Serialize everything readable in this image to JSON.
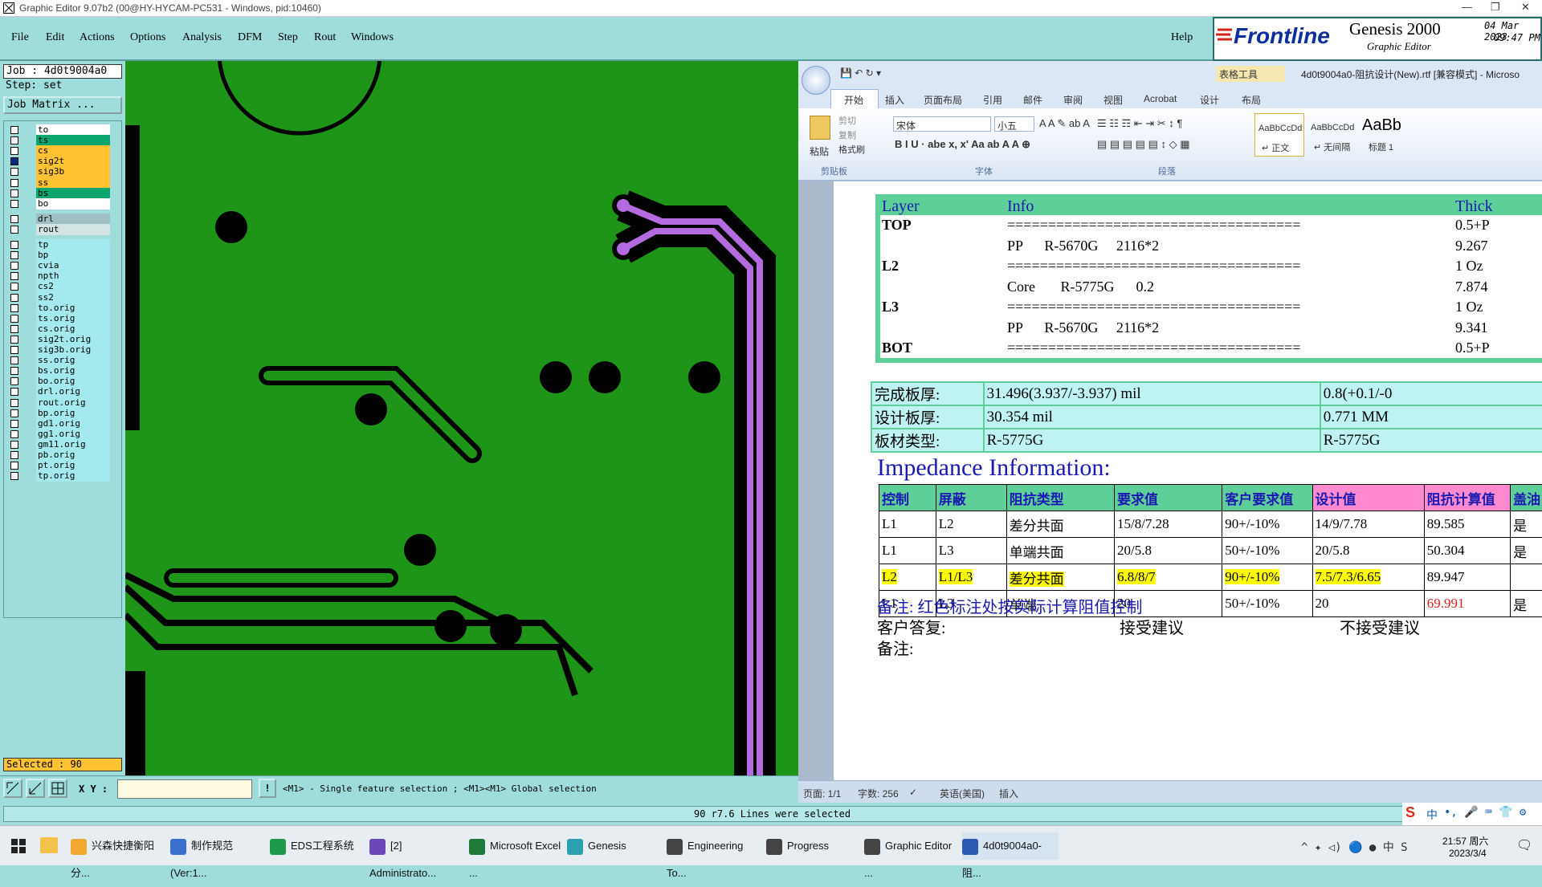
{
  "window": {
    "title": "Graphic Editor 9.07b2 (00@HY-HYCAM-PC531 - Windows, pid:10460)"
  },
  "menu": [
    "File",
    "Edit",
    "Actions",
    "Options",
    "Analysis",
    "DFM",
    "Step",
    "Rout",
    "Windows"
  ],
  "menu_help": "Help",
  "logo": {
    "brand": "Frontline",
    "product": "Genesis 2000",
    "subtitle": "Graphic Editor",
    "date": "04 Mar 2023",
    "time": "09:47 PM"
  },
  "job": {
    "job_line": "Job : 4d0t9004a0",
    "step_line": "Step: set",
    "matrix_button": "Job Matrix ..."
  },
  "layers": [
    {
      "name": "to",
      "color": "#ffffff"
    },
    {
      "name": "ts",
      "color": "#0aa66e"
    },
    {
      "name": "cs",
      "color": "#ffc233"
    },
    {
      "name": "sig2t",
      "color": "#ffc233"
    },
    {
      "name": "sig3b",
      "color": "#ffc233"
    },
    {
      "name": "ss",
      "color": "#ffc233"
    },
    {
      "name": "bs",
      "color": "#0aa66e"
    },
    {
      "name": "bo",
      "color": "#ffffff"
    },
    {
      "name": "drl",
      "color": "#9fbfc4"
    },
    {
      "name": "rout",
      "color": "#d4e4e4"
    },
    {
      "name": "tp",
      "color": "#a3e9ee"
    },
    {
      "name": "bp",
      "color": "#a3e9ee"
    },
    {
      "name": "cvia",
      "color": "#a3e9ee"
    },
    {
      "name": "npth",
      "color": "#a3e9ee"
    },
    {
      "name": "cs2",
      "color": "#a3e9ee"
    },
    {
      "name": "ss2",
      "color": "#a3e9ee"
    },
    {
      "name": "to.orig",
      "color": "#a3e9ee"
    },
    {
      "name": "ts.orig",
      "color": "#a3e9ee"
    },
    {
      "name": "cs.orig",
      "color": "#a3e9ee"
    },
    {
      "name": "sig2t.orig",
      "color": "#a3e9ee"
    },
    {
      "name": "sig3b.orig",
      "color": "#a3e9ee"
    },
    {
      "name": "ss.orig",
      "color": "#a3e9ee"
    },
    {
      "name": "bs.orig",
      "color": "#a3e9ee"
    },
    {
      "name": "bo.orig",
      "color": "#a3e9ee"
    },
    {
      "name": "drl.orig",
      "color": "#a3e9ee"
    },
    {
      "name": "rout.orig",
      "color": "#a3e9ee"
    },
    {
      "name": "bp.orig",
      "color": "#a3e9ee"
    },
    {
      "name": "gd1.orig",
      "color": "#a3e9ee"
    },
    {
      "name": "gg1.orig",
      "color": "#a3e9ee"
    },
    {
      "name": "gm11.orig",
      "color": "#a3e9ee"
    },
    {
      "name": "pb.orig",
      "color": "#a3e9ee"
    },
    {
      "name": "pt.orig",
      "color": "#a3e9ee"
    },
    {
      "name": "tp.orig",
      "color": "#a3e9ee"
    }
  ],
  "selected_count": "Selected : 90",
  "cmd": {
    "xy_label": "X Y :",
    "hint": "<M1> - Single feature selection ; <M1><M1> Global selection"
  },
  "status_message": "90 r7.6 Lines were selected",
  "word": {
    "doc_title": "4d0t9004a0-阻抗设计(New).rtf [兼容模式] - Microso",
    "context_tab": "表格工具",
    "tabs": [
      "开始",
      "插入",
      "页面布局",
      "引用",
      "邮件",
      "审阅",
      "视图",
      "Acrobat",
      "设计",
      "布局"
    ],
    "clipboard": {
      "paste": "粘贴",
      "cut": "剪切",
      "copy": "复制",
      "painter": "格式刷",
      "group": "剪贴板"
    },
    "font": {
      "name": "宋体",
      "size": "小五",
      "group": "字体"
    },
    "para_group": "段落",
    "styles": [
      {
        "sample": "AaBbCcDd",
        "label": "↵ 正文"
      },
      {
        "sample": "AaBbCcDd",
        "label": "↵ 无间隔"
      },
      {
        "sample": "AaBb",
        "label": "标题 1"
      }
    ],
    "stack_header": [
      "Layer",
      "Info",
      "Thick"
    ],
    "stack_rows": [
      [
        "TOP",
        "====================================",
        "0.5+P"
      ],
      [
        "",
        "PP      R-5670G     2116*2",
        "9.267"
      ],
      [
        "L2",
        "====================================",
        "1 Oz"
      ],
      [
        "",
        "Core       R-5775G      0.2",
        "7.874"
      ],
      [
        "L3",
        "====================================",
        "1 Oz"
      ],
      [
        "",
        "PP      R-5670G     2116*2",
        "9.341"
      ],
      [
        "BOT",
        "====================================",
        "0.5+P"
      ]
    ],
    "thickness_rows": [
      [
        "完成板厚:",
        "31.496(3.937/-3.937) mil",
        "0.8(+0.1/-0"
      ],
      [
        "设计板厚:",
        "30.354 mil",
        "0.771 MM"
      ],
      [
        "板材类型:",
        "R-5775G",
        "R-5775G"
      ]
    ],
    "impedance_title": "Impedance Information:",
    "imp_header": [
      "控制",
      "屏蔽",
      "阻抗类型",
      "要求值",
      "客户要求值",
      "设计值",
      "阻抗计算值",
      "盖油"
    ],
    "imp_rows": [
      [
        "L1",
        "L2",
        "差分共面",
        "15/8/7.28",
        "90+/-10%",
        "14/9/7.78",
        "89.585",
        "是"
      ],
      [
        "L1",
        "L3",
        "单端共面",
        "20/5.8",
        "50+/-10%",
        "20/5.8",
        "50.304",
        "是"
      ],
      [
        "L2",
        "L1/L3",
        "差分共面",
        "6.8/8/7",
        "90+/-10%",
        "7.5/7.3/6.65",
        "89.947",
        ""
      ],
      [
        "L1",
        "L3",
        "单端",
        "20",
        "50+/-10%",
        "20",
        "69.991",
        "是"
      ]
    ],
    "note1": "备注: 红色标注处按实际计算阻值控制",
    "reply_label": "客户答复:",
    "accept": "接受建议",
    "reject": "不接受建议",
    "note2": "备注:",
    "status": {
      "page": "页面: 1/1",
      "words": "字数: 256",
      "lang": "英语(美国)",
      "mode": "插入"
    }
  },
  "taskbar": {
    "items": [
      "兴森快捷衡阳分...",
      "制作规范 (Ver:1...",
      "EDS工程系统",
      "[2] Administrato...",
      "Microsoft Excel ...",
      "Genesis",
      "Engineering To...",
      "Progress",
      "Graphic Editor ...",
      "4d0t9004a0-阻..."
    ],
    "time": "21:57 周六",
    "date": "2023/3/4",
    "ime": "中"
  }
}
